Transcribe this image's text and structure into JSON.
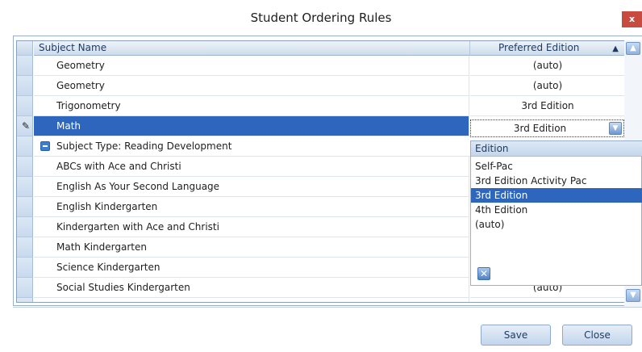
{
  "window": {
    "title": "Student Ordering Rules",
    "close_label": "x"
  },
  "grid": {
    "columns": {
      "subject": "Subject Name",
      "edition": "Preferred Edition"
    },
    "rows": [
      {
        "name": "Geometry",
        "edition": "(auto)"
      },
      {
        "name": "Geometry",
        "edition": "(auto)"
      },
      {
        "name": "Trigonometry",
        "edition": "3rd Edition"
      },
      {
        "name": "Math",
        "edition": "3rd Edition",
        "selected": true
      }
    ],
    "group_label": "Subject Type: Reading Development",
    "group_rows": [
      {
        "name": "ABCs with Ace and Christi"
      },
      {
        "name": "English As Your Second Language"
      },
      {
        "name": "English Kindergarten"
      },
      {
        "name": "Kindergarten with Ace and Christi"
      },
      {
        "name": "Math Kindergarten"
      },
      {
        "name": "Science Kindergarten"
      },
      {
        "name": "Social Studies Kindergarten",
        "edition": "(auto)"
      }
    ]
  },
  "dropdown": {
    "header": "Edition",
    "options": [
      "Self-Pac",
      "3rd Edition Activity Pac",
      "3rd Edition",
      "4th Edition",
      "(auto)"
    ],
    "selected": "3rd Edition"
  },
  "buttons": {
    "save": "Save",
    "close": "Close"
  },
  "colors": {
    "selection": "#2f66bd",
    "header": "#cddcec",
    "accent": "#6f97cf"
  }
}
